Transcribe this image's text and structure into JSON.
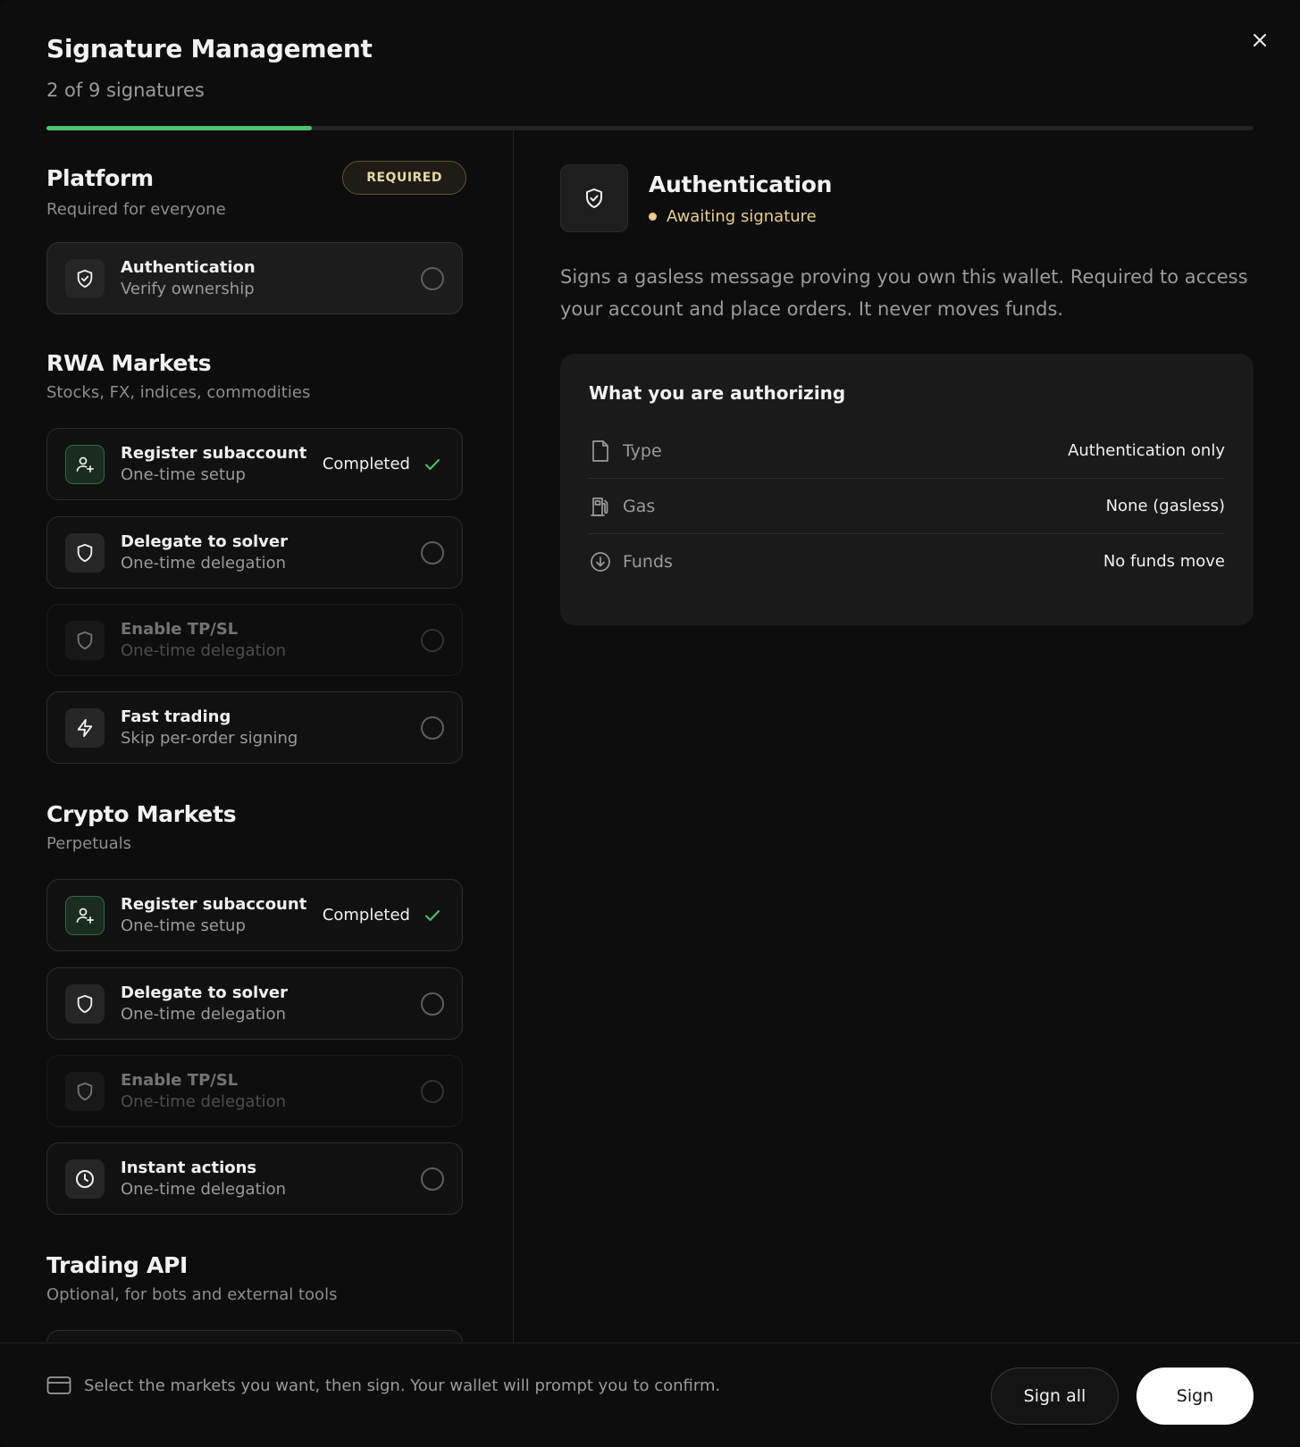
{
  "header": {
    "title": "Signature Management",
    "subtitle": "2 of 9 signatures",
    "progress": 0.22
  },
  "sections": {
    "platform": {
      "title": "Platform",
      "badge": "REQUIRED",
      "desc": "Required for everyone",
      "items": [
        {
          "title": "Authentication",
          "sub": "Verify ownership",
          "icon": "shield-check-icon",
          "state": "pending"
        }
      ]
    },
    "rwa": {
      "title": "RWA Markets",
      "desc": "Stocks, FX, indices, commodities",
      "items": [
        {
          "title": "Register subaccount",
          "sub": "One-time setup",
          "icon": "user-plus-icon",
          "state": "completed",
          "status": "Completed"
        },
        {
          "title": "Delegate to solver",
          "sub": "One-time delegation",
          "icon": "shield-icon",
          "state": "pending"
        },
        {
          "title": "Enable TP/SL",
          "sub": "One-time delegation",
          "icon": "shield-icon",
          "state": "disabled"
        },
        {
          "title": "Fast trading",
          "sub": "Skip per-order signing",
          "icon": "lightning-icon",
          "state": "pending"
        }
      ]
    },
    "crypto": {
      "title": "Crypto Markets",
      "desc": "Perpetuals",
      "items": [
        {
          "title": "Register subaccount",
          "sub": "One-time setup",
          "icon": "user-plus-icon",
          "state": "completed",
          "status": "Completed"
        },
        {
          "title": "Delegate to solver",
          "sub": "One-time delegation",
          "icon": "shield-icon",
          "state": "pending"
        },
        {
          "title": "Enable TP/SL",
          "sub": "One-time delegation",
          "icon": "shield-icon",
          "state": "disabled"
        },
        {
          "title": "Instant actions",
          "sub": "One-time delegation",
          "icon": "clock-icon",
          "state": "pending"
        }
      ]
    },
    "api": {
      "title": "Trading API",
      "desc": "Optional, for bots and external tools"
    }
  },
  "detail": {
    "title": "Authentication",
    "status": "Awaiting signature",
    "description": "Signs a gasless message proving you own this wallet. Required to access your account and place orders. It never moves funds.",
    "box_title": "What you are authorizing",
    "rows": [
      {
        "label": "Type",
        "value": "Authentication only",
        "icon": "document-icon"
      },
      {
        "label": "Gas",
        "value": "None (gasless)",
        "icon": "fuel-pump-icon"
      },
      {
        "label": "Funds",
        "value": "No funds move",
        "icon": "arrow-down-circle-icon"
      }
    ]
  },
  "footer": {
    "message": "Select the markets you want, then sign. Your wallet will prompt you to confirm.",
    "sign_all": "Sign all",
    "sign": "Sign"
  },
  "colors": {
    "accent_green": "#4cc26b",
    "awaiting_yellow": "#e7cf87",
    "background": "#0d0d0d"
  }
}
